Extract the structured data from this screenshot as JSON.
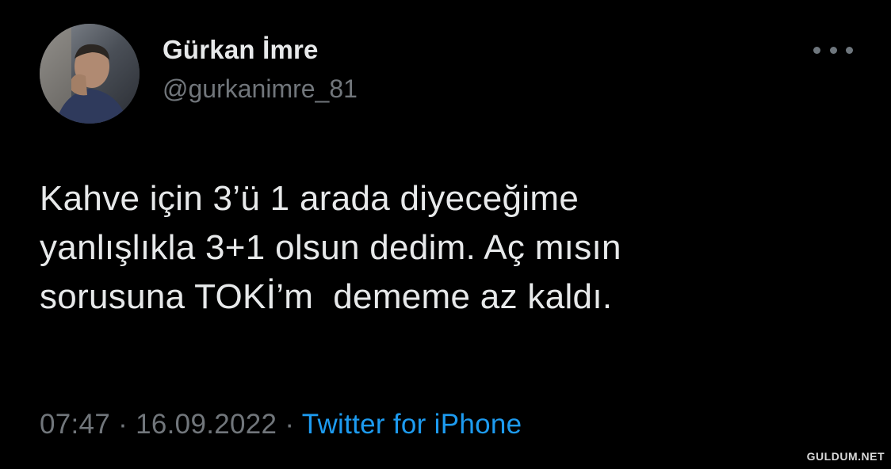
{
  "user": {
    "name": "Gürkan İmre",
    "handle": "@gurkanimre_81"
  },
  "tweet": {
    "lines": [
      "Kahve için 3’ü 1 arada diyeceğime",
      "yanlışlıkla 3+1 olsun dedim. Aç mısın",
      "sorusuna TOKİ’m  dememe az kaldı."
    ],
    "time": "07:47",
    "separator": "·",
    "date": "16.09.2022",
    "source": "Twitter for iPhone"
  },
  "icons": {
    "more": "more-horizontal-icon"
  },
  "colors": {
    "background": "#000000",
    "text": "#e7e9ea",
    "secondary": "#71767b",
    "link": "#1d9bf0"
  },
  "watermark": "GULDUM.NET"
}
